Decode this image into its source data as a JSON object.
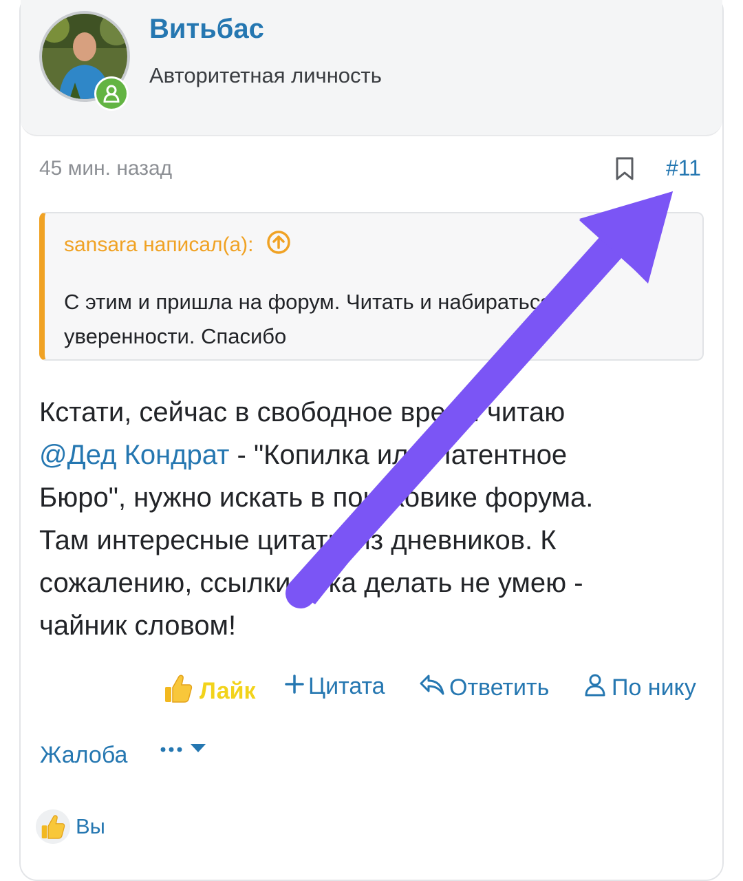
{
  "post": {
    "author": "Витьбас",
    "author_title": "Авторитетная личность",
    "time": "45 мин. назад",
    "number": "#11"
  },
  "quote": {
    "author": "sansara написал(а):",
    "text": "С этим и пришла на форум. Читать и набираться уверенности. Спасибо"
  },
  "message": {
    "line1": "Кстати, сейчас в свободное время читаю",
    "mention": "@Дед Кондрат",
    "line2_rest": " - \"Копилка или Патентное",
    "line3": "Бюро\", нужно искать в поисковике форума.",
    "line4": "Там интересные цитаты из дневников. К",
    "line5": "сожалению, ссылки пока делать не умею -",
    "line6": "чайник словом!"
  },
  "actions": {
    "like": "Лайк",
    "quote": "Цитата",
    "reply": "Ответить",
    "by_nick": "По нику",
    "report": "Жалоба"
  },
  "reactions": {
    "label": "Вы"
  },
  "colors": {
    "link": "#2577b1",
    "quote_accent": "#f0a224",
    "like": "#f2d31b",
    "online": "#63b443",
    "annotation_arrow": "#7b55f5"
  },
  "icons": {
    "online": "user-online-icon",
    "bookmark": "bookmark-icon",
    "quote_jump": "arrow-up-circle-icon",
    "like": "thumbs-up-icon",
    "quote": "plus-icon",
    "reply": "reply-icon",
    "by_nick": "user-icon",
    "more": "more-dots-icon"
  }
}
